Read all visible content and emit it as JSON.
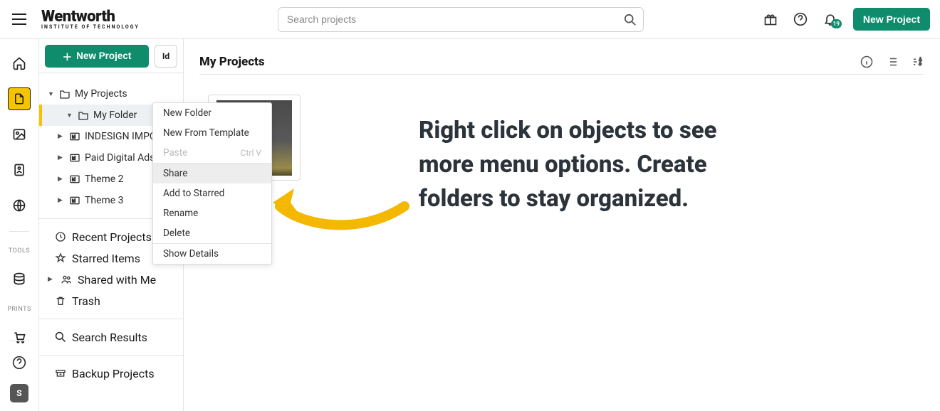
{
  "brand": {
    "main": "Wentworth",
    "sub": "INSTITUTE OF TECHNOLOGY"
  },
  "search": {
    "placeholder": "Search projects"
  },
  "topbar": {
    "new_project": "New Project",
    "notification_count": "19"
  },
  "iconbar": {
    "tools_label": "TOOLS",
    "prints_label": "PRINTS",
    "user_initial": "S"
  },
  "sidebar": {
    "new_project": "New Project",
    "id_label": "Id",
    "tree": {
      "root": "My Projects",
      "my_folder": "My Folder",
      "indesign": "INDESIGN IMPORT",
      "paid_ads": "Paid Digital Ads",
      "theme2": "Theme 2",
      "theme3": "Theme 3"
    },
    "recent": "Recent Projects",
    "starred": "Starred Items",
    "shared": "Shared with Me",
    "trash": "Trash",
    "search_results": "Search Results",
    "backup": "Backup Projects"
  },
  "content": {
    "title": "My Projects"
  },
  "context_menu": {
    "new_folder": "New Folder",
    "new_template": "New From Template",
    "paste": "Paste",
    "paste_shortcut": "Ctrl V",
    "share": "Share",
    "add_starred": "Add to Starred",
    "rename": "Rename",
    "delete": "Delete",
    "show_details": "Show Details"
  },
  "annotation": "Right click on objects to see more menu options. Create folders to stay organized."
}
